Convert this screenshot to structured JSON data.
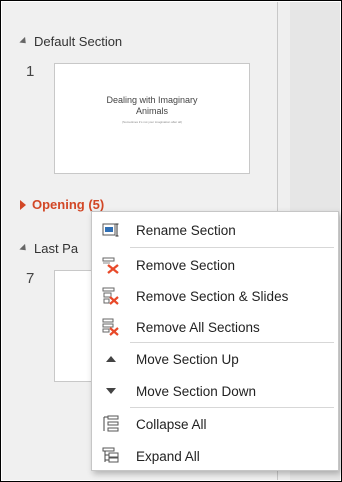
{
  "sections": {
    "default": {
      "label": "Default Section",
      "slide_number": "1"
    },
    "opening": {
      "label": "Opening (5)"
    },
    "last": {
      "label": "Last Pa",
      "slide_number": "7"
    }
  },
  "slide1": {
    "title_line1": "Dealing with Imaginary",
    "title_line2": "Animals",
    "subtitle": "(Sometimes it's not your imagination after all)"
  },
  "context_menu": {
    "items": [
      {
        "id": "rename",
        "label": "Rename Section",
        "icon": "rename-section-icon"
      },
      {
        "id": "remove",
        "label": "Remove Section",
        "icon": "remove-section-icon"
      },
      {
        "id": "remove-slides",
        "label": "Remove Section & Slides",
        "icon": "remove-section-slides-icon"
      },
      {
        "id": "remove-all",
        "label": "Remove All Sections",
        "icon": "remove-all-sections-icon"
      },
      {
        "id": "move-up",
        "label": "Move Section Up",
        "icon": "triangle-up-icon"
      },
      {
        "id": "move-down",
        "label": "Move Section Down",
        "icon": "triangle-down-icon"
      },
      {
        "id": "collapse-all",
        "label": "Collapse All",
        "icon": "collapse-all-icon"
      },
      {
        "id": "expand-all",
        "label": "Expand All",
        "icon": "expand-all-icon"
      }
    ]
  },
  "colors": {
    "accent": "#d24726",
    "remove_x": "#e84a2a",
    "icon_blue": "#2f6fb5"
  }
}
